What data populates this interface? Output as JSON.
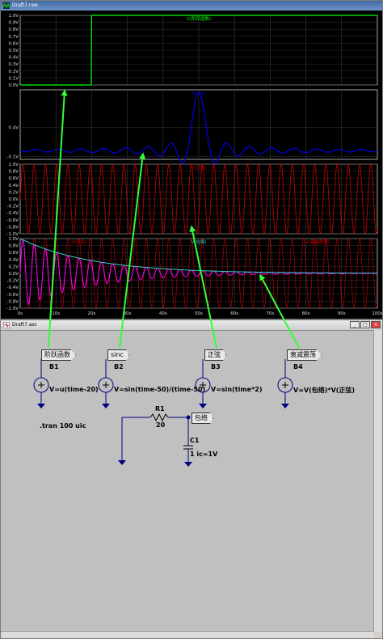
{
  "waveform_window": {
    "title": "Draft7.raw",
    "panes": [
      {
        "trace_label": "V(阶跃函数)",
        "y_ticks": [
          "1.0V",
          "0.9V",
          "0.8V",
          "0.7V",
          "0.6V",
          "0.5V",
          "0.4V",
          "0.3V",
          "0.2V",
          "0.1V",
          "0.0V"
        ],
        "color": "#00ff00"
      },
      {
        "trace_label": "V(sinc)",
        "y_ticks": [
          "0.4V",
          "-0.1V"
        ],
        "color": "#0000cc"
      },
      {
        "trace_label": "V(正弦)",
        "y_ticks": [
          "1.0V",
          "0.8V",
          "0.6V",
          "0.4V",
          "0.2V",
          "0.0V",
          "-0.2V",
          "-0.4V",
          "-0.6V",
          "-0.8V",
          "-1.0V"
        ],
        "color": "#cc0000"
      },
      {
        "trace_labels": [
          "V(正弦)",
          "V(包络)",
          "V(衰减震荡)"
        ],
        "y_ticks": [
          "1.0V",
          "0.8V",
          "0.6V",
          "0.4V",
          "0.2V",
          "0.0V",
          "-0.2V",
          "-0.4V",
          "-0.6V",
          "-0.8V",
          "-1.0V"
        ],
        "colors": [
          "#cc0000",
          "#33cccc",
          "#ff00ff"
        ]
      }
    ],
    "x_ticks": [
      "0s",
      "10s",
      "20s",
      "30s",
      "40s",
      "50s",
      "60s",
      "70s",
      "80s",
      "90s",
      "100s"
    ],
    "annotation_arrow_color": "#33ff33"
  },
  "schematic_window": {
    "title": "Draft7.asc",
    "sources": [
      {
        "ref": "B1",
        "net": "阶跃函数",
        "expr": "V=u(time-20)"
      },
      {
        "ref": "B2",
        "net": "sinc",
        "expr": "V=sin(time-50)/(time-50)"
      },
      {
        "ref": "B3",
        "net": "正弦",
        "expr": "V=sin(time*2)"
      },
      {
        "ref": "B4",
        "net": "衰减震荡",
        "expr": "V=V(包络)*V(正弦)"
      }
    ],
    "directive": ".tran 100 uic",
    "resistor": {
      "ref": "R1",
      "value": "20"
    },
    "capacitor": {
      "ref": "C1",
      "value": "1 ic=1V"
    },
    "rc_net": "包络"
  },
  "window_buttons": {
    "minimize": "_",
    "maximize": "□",
    "close": "×"
  }
}
